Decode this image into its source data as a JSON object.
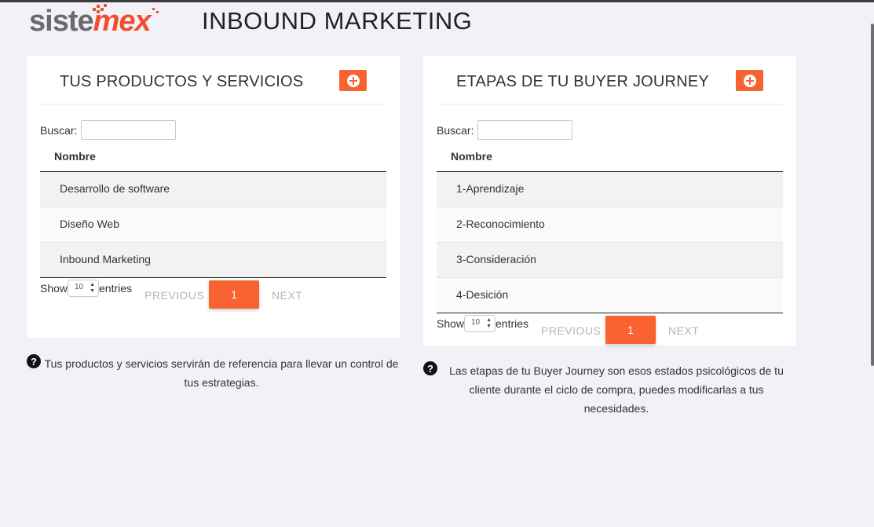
{
  "brand": {
    "logo_part1": "siste",
    "logo_part2": "mex"
  },
  "page": {
    "title": "INBOUND MARKETING"
  },
  "left_panel": {
    "title": "TUS PRODUCTOS Y SERVICIOS",
    "search_label": "Buscar:",
    "search_value": "",
    "column_header": "Nombre",
    "rows": [
      "Desarrollo de software",
      "Diseño Web",
      "Inbound Marketing"
    ],
    "show_label": "Show",
    "page_length": "10",
    "entries_label": "entries",
    "prev_label": "PREVIOUS",
    "current_page": "1",
    "next_label": "NEXT",
    "help_text": "Tus productos y servicios servirán de referencia para llevar un control de tus estrategias."
  },
  "right_panel": {
    "title": "ETAPAS DE TU BUYER JOURNEY",
    "search_label": "Buscar:",
    "search_value": "",
    "column_header": "Nombre",
    "rows": [
      "1-Aprendizaje",
      "2-Reconocimiento",
      "3-Consideración",
      "4-Desición"
    ],
    "show_label": "Show",
    "page_length": "10",
    "entries_label": "entries",
    "prev_label": "PREVIOUS",
    "current_page": "1",
    "next_label": "NEXT",
    "help_text": "Las etapas de tu Buyer Journey son esos estados psicológicos de tu cliente durante el ciclo de compra, puedes modificarlas a tus necesidades."
  },
  "colors": {
    "accent": "#f96332",
    "brand_red": "#f04e30",
    "background": "#f1f2f7"
  },
  "icons": {
    "add": "plus-circle-icon",
    "help": "question-circle-icon"
  }
}
